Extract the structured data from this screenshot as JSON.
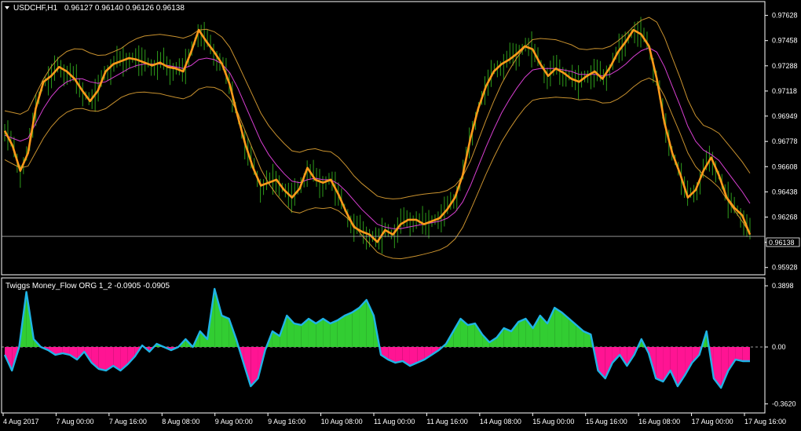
{
  "main_panel": {
    "symbol": "USDCHF,H1",
    "ohlc": "0.96127 0.96140 0.96126 0.96138",
    "current_price_label": "0.96138"
  },
  "indicator_panel": {
    "name": "Twiggs Money_Flow ORG 1_2 -0.0905 -0.0905",
    "zero_label": "0.00"
  },
  "colors": {
    "background": "#000000",
    "candles": "#2e9c1a",
    "fast_ma": "#ff9a1a",
    "slow_ma": "#d83fd2",
    "bands": "#c8912e",
    "pos_area": "#32cd32",
    "neg_area": "#ff1493",
    "tmf_line": "#1fb4e6",
    "price_line": "#a8a8a8"
  },
  "chart_data": [
    {
      "type": "line",
      "name": "price",
      "categories": [
        "4 Aug 2017",
        "7 Aug 00:00",
        "7 Aug 16:00",
        "8 Aug 08:00",
        "9 Aug 00:00",
        "9 Aug 16:00",
        "10 Aug 08:00",
        "11 Aug 00:00",
        "11 Aug 16:00",
        "14 Aug 08:00",
        "15 Aug 00:00",
        "15 Aug 16:00",
        "16 Aug 08:00",
        "17 Aug 00:00",
        "17 Aug 16:00"
      ],
      "ylim": [
        0.959,
        0.977
      ],
      "yticks": [
        "0.97628",
        "0.97458",
        "0.97288",
        "0.97118",
        "0.96949",
        "0.96778",
        "0.96608",
        "0.96438",
        "0.96268",
        "0.96098",
        "0.95928"
      ],
      "current_price": 0.96138,
      "series": [
        {
          "values": [
            0.9685,
            0.9675,
            0.9658,
            0.967,
            0.97,
            0.9718,
            0.9722,
            0.9728,
            0.9725,
            0.972,
            0.9712,
            0.9705,
            0.9712,
            0.9725,
            0.973,
            0.9732,
            0.9734,
            0.9733,
            0.9731,
            0.9729,
            0.9731,
            0.9728,
            0.9727,
            0.9725,
            0.9738,
            0.9753,
            0.9745,
            0.9738,
            0.973,
            0.9716,
            0.9695,
            0.9676,
            0.966,
            0.9648,
            0.965,
            0.9652,
            0.9645,
            0.964,
            0.9646,
            0.966,
            0.9652,
            0.965,
            0.9652,
            0.9642,
            0.963,
            0.962,
            0.9617,
            0.9615,
            0.961,
            0.9618,
            0.9615,
            0.9622,
            0.9625,
            0.9625,
            0.9622,
            0.9624,
            0.9626,
            0.9632,
            0.964,
            0.9655,
            0.968,
            0.97,
            0.9715,
            0.9725,
            0.973,
            0.9733,
            0.9737,
            0.9742,
            0.974,
            0.973,
            0.9722,
            0.9727,
            0.9724,
            0.972,
            0.9718,
            0.9722,
            0.9725,
            0.972,
            0.9728,
            0.9738,
            0.9745,
            0.9753,
            0.975,
            0.9742,
            0.972,
            0.969,
            0.967,
            0.9656,
            0.964,
            0.9645,
            0.9658,
            0.9667,
            0.9655,
            0.964,
            0.9633,
            0.9628,
            0.9615
          ]
        },
        {
          "values": [
            0.9682,
            0.968,
            0.9678,
            0.968,
            0.969,
            0.97,
            0.9708,
            0.9714,
            0.9718,
            0.972,
            0.972,
            0.9718,
            0.9717,
            0.9718,
            0.9721,
            0.9724,
            0.9727,
            0.9729,
            0.973,
            0.973,
            0.973,
            0.9729,
            0.9728,
            0.9727,
            0.9729,
            0.9733,
            0.9734,
            0.9733,
            0.973,
            0.9724,
            0.9714,
            0.9702,
            0.969,
            0.9678,
            0.9669,
            0.9662,
            0.9656,
            0.9651,
            0.965,
            0.9652,
            0.9653,
            0.9652,
            0.9652,
            0.9649,
            0.9644,
            0.9638,
            0.9632,
            0.9627,
            0.9622,
            0.962,
            0.9619,
            0.9619,
            0.962,
            0.9621,
            0.9622,
            0.9623,
            0.9624,
            0.9626,
            0.963,
            0.9637,
            0.9648,
            0.9661,
            0.9674,
            0.9686,
            0.9697,
            0.9706,
            0.9714,
            0.9721,
            0.9726,
            0.9727,
            0.9727,
            0.9727,
            0.9726,
            0.9725,
            0.9723,
            0.9723,
            0.9723,
            0.9722,
            0.9723,
            0.9726,
            0.973,
            0.9735,
            0.9739,
            0.9741,
            0.9738,
            0.9728,
            0.9715,
            0.9702,
            0.9688,
            0.9678,
            0.9672,
            0.9669,
            0.9665,
            0.9658,
            0.9651,
            0.9644,
            0.9636
          ]
        }
      ]
    },
    {
      "type": "area",
      "name": "Twiggs Money_Flow",
      "ylim": [
        -0.4,
        0.4
      ],
      "yticks": [
        "0.3898",
        "0.00",
        "-0.3620"
      ],
      "values": [
        -0.05,
        -0.15,
        0.0,
        0.35,
        0.05,
        0.0,
        -0.02,
        -0.05,
        -0.04,
        -0.05,
        -0.08,
        -0.03,
        -0.1,
        -0.14,
        -0.15,
        -0.12,
        -0.15,
        -0.11,
        -0.06,
        0.01,
        -0.03,
        0.02,
        0.0,
        -0.02,
        0.0,
        0.05,
        0.0,
        0.1,
        0.05,
        0.37,
        0.2,
        0.18,
        0.05,
        -0.1,
        -0.25,
        -0.2,
        -0.02,
        0.1,
        0.07,
        0.2,
        0.15,
        0.14,
        0.18,
        0.15,
        0.18,
        0.15,
        0.17,
        0.2,
        0.22,
        0.25,
        0.3,
        0.2,
        -0.05,
        -0.08,
        -0.1,
        -0.09,
        -0.12,
        -0.1,
        -0.08,
        -0.05,
        -0.02,
        0.02,
        0.1,
        0.18,
        0.14,
        0.15,
        0.08,
        0.03,
        0.06,
        0.12,
        0.1,
        0.16,
        0.18,
        0.12,
        0.2,
        0.15,
        0.25,
        0.22,
        0.18,
        0.14,
        0.1,
        0.08,
        -0.15,
        -0.2,
        -0.1,
        -0.05,
        -0.12,
        -0.05,
        0.05,
        -0.04,
        -0.2,
        -0.22,
        -0.15,
        -0.25,
        -0.18,
        -0.1,
        -0.05,
        0.1,
        -0.2,
        -0.26,
        -0.15,
        -0.08,
        -0.09,
        -0.09
      ]
    }
  ]
}
